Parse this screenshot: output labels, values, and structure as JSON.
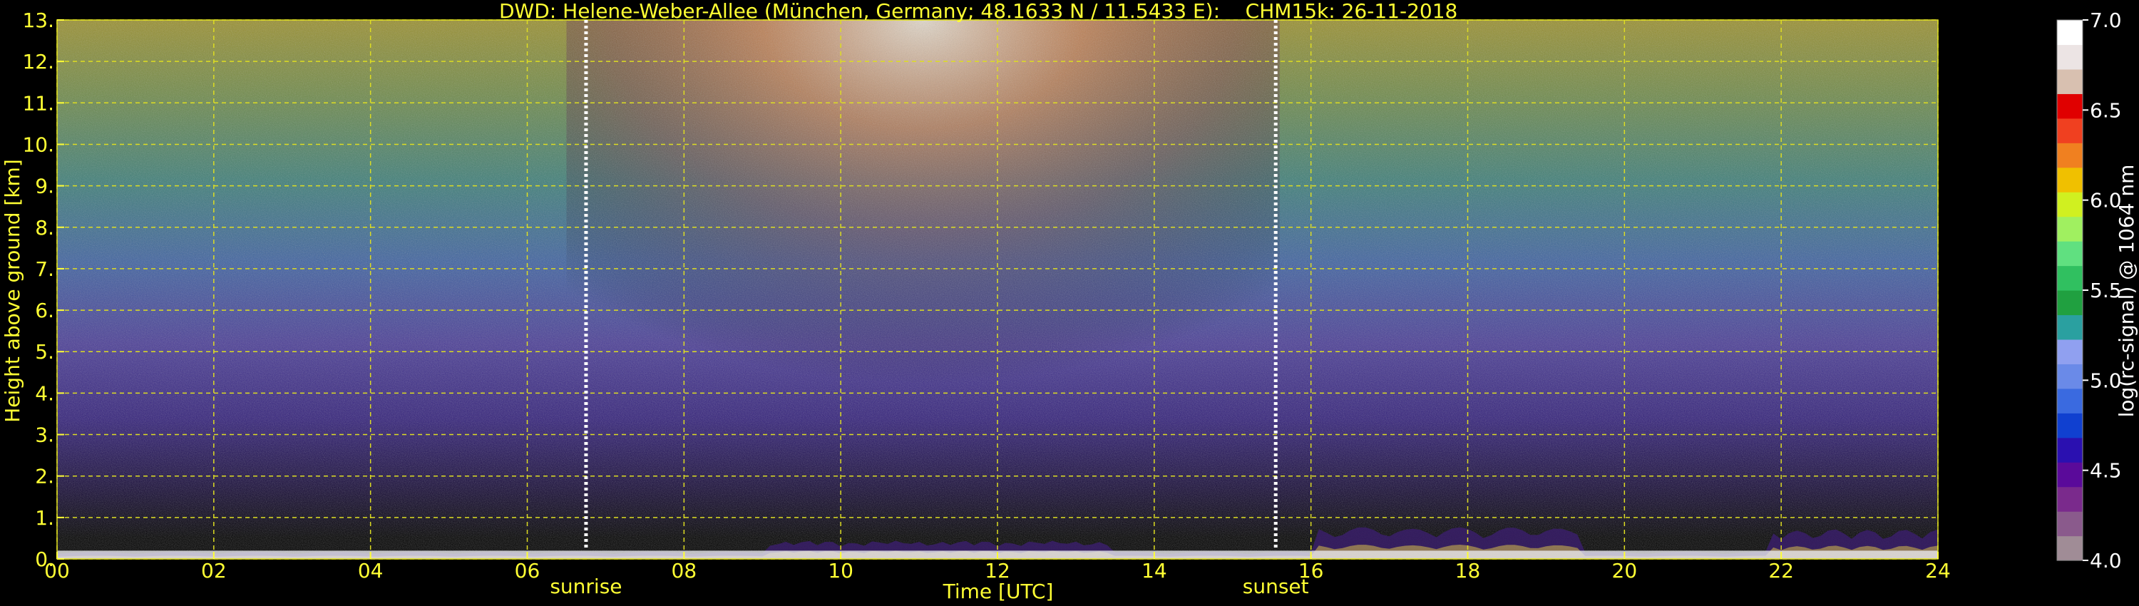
{
  "chart_data": {
    "type": "heatmap",
    "title_station": "DWD: Helene-Weber-Allee (München, Germany; 48.1633 N / 11.5433 E):",
    "title_instrument": "CHM15k: 26-11-2018",
    "xlabel": "Time [UTC]",
    "ylabel": "Height above ground [km]",
    "colorbar_label": "log(rc-signal) @ 1064 nm",
    "xlim": [
      0,
      24
    ],
    "ylim": [
      0,
      13
    ],
    "x_ticks": [
      "00",
      "02",
      "04",
      "06",
      "08",
      "10",
      "12",
      "14",
      "16",
      "18",
      "20",
      "22",
      "24"
    ],
    "y_ticks": [
      "0.",
      "1.",
      "2.",
      "3.",
      "4.",
      "5.",
      "6.",
      "7.",
      "8.",
      "9.",
      "10.",
      "11.",
      "12.",
      "13."
    ],
    "colorbar_range": [
      4.0,
      7.0
    ],
    "colorbar_ticks": [
      "4.0",
      "4.5",
      "5.0",
      "5.5",
      "6.0",
      "6.5",
      "7.0"
    ],
    "colorbar_colors": [
      "#a08c96",
      "#8a5a8c",
      "#7a2a8c",
      "#5a0a9a",
      "#2a10b0",
      "#1040d0",
      "#3a6ae0",
      "#6a8ae8",
      "#90a0f0",
      "#2aa0a0",
      "#20a040",
      "#30c060",
      "#60e080",
      "#a0f060",
      "#d0f020",
      "#f0c000",
      "#f08020",
      "#f04020",
      "#e00000",
      "#d8c0b0",
      "#ece4e4",
      "#ffffff"
    ],
    "events": [
      {
        "label": "sunrise",
        "time_utc": 6.75
      },
      {
        "label": "sunset",
        "time_utc": 15.55
      }
    ],
    "grid": true,
    "colors": {
      "text": "#ffff33",
      "grid": "#dddd22",
      "background": "#000000",
      "event_line": "#ffffff"
    }
  }
}
